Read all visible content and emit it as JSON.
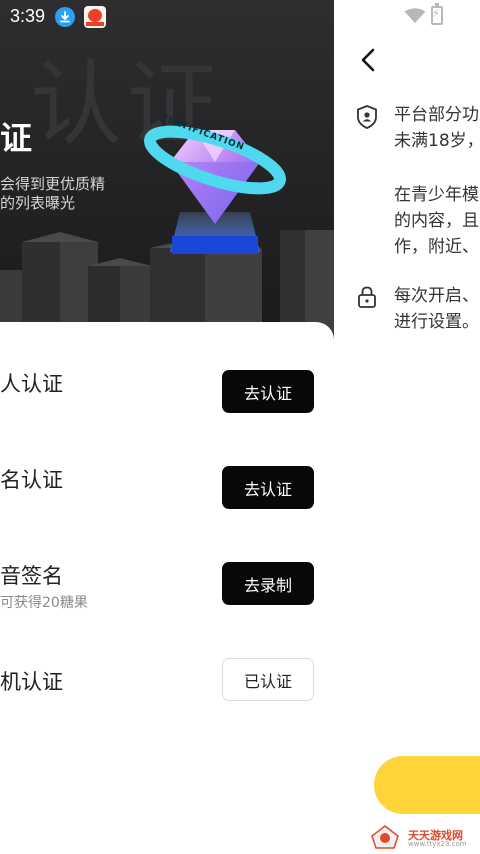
{
  "status_bar": {
    "time": "3:39"
  },
  "hero": {
    "title": "证",
    "description_line1": "会得到更优质精",
    "description_line2": "的列表曝光",
    "background_text": "认证",
    "badge_text": "CERTIFICATION"
  },
  "verification_list": [
    {
      "title": "人认证",
      "subtitle": "",
      "button_label": "去认证",
      "state": "pending"
    },
    {
      "title": "名认证",
      "subtitle": "",
      "button_label": "去认证",
      "state": "pending"
    },
    {
      "title": "音签名",
      "subtitle": "可获得20糖果",
      "button_label": "去录制",
      "state": "pending"
    },
    {
      "title": "机认证",
      "subtitle": "",
      "button_label": "已认证",
      "state": "done"
    }
  ],
  "right_panel": {
    "info_line1": "平台部分功",
    "info_line2": "未满18岁，",
    "info_line3": "在青少年模",
    "info_line4": "的内容，且",
    "info_line5": "作，附近、",
    "lock_line1": "每次开启、",
    "lock_line2": "进行设置。"
  },
  "watermark": {
    "text": "天天游戏网",
    "url": "www.ttyx23.com"
  },
  "colors": {
    "accent_yellow": "#ffd43a",
    "button_black": "#080808",
    "hero_dark": "#262628"
  }
}
